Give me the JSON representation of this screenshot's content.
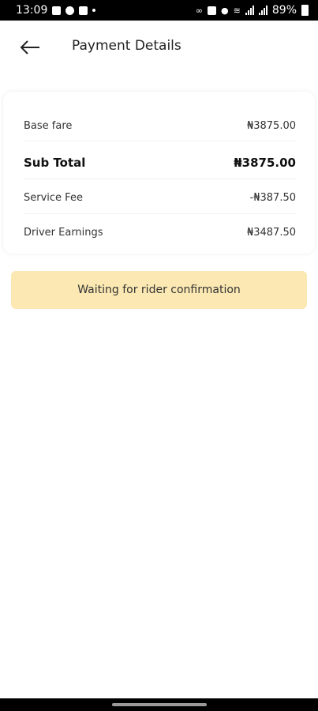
{
  "status_bar": {
    "time": "13:09",
    "battery": "89%"
  },
  "header": {
    "title": "Payment Details"
  },
  "payment": {
    "rows": [
      {
        "label": "Base fare",
        "value": "₦3875.00"
      },
      {
        "label": "Sub Total",
        "value": "₦3875.00"
      },
      {
        "label": "Service Fee",
        "value": "-₦387.50"
      },
      {
        "label": "Driver Earnings",
        "value": "₦3487.50"
      }
    ]
  },
  "status_banner": {
    "text": "Waiting for rider confirmation"
  },
  "colors": {
    "banner_bg": "#fbe8b2",
    "status_bar_bg": "#000000"
  }
}
